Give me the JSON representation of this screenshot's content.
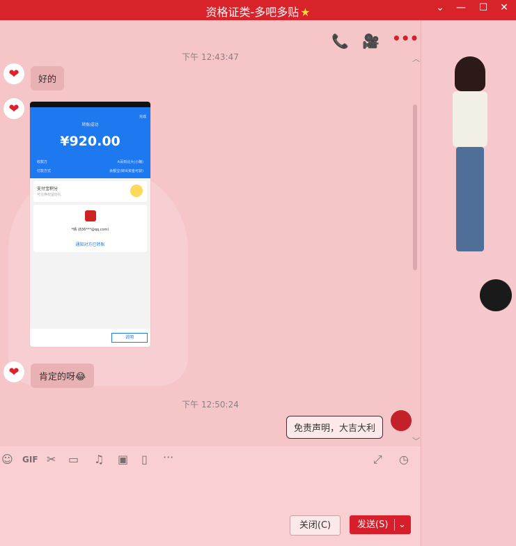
{
  "window": {
    "title": "资格证类-多吧多贴",
    "star_icon": "star-icon",
    "accent": "#d9232b"
  },
  "chat": {
    "timestamps": [
      "下午 12:43:47",
      "下午 12:50:24"
    ],
    "messages": [
      {
        "from": "friend",
        "text": "好的"
      },
      {
        "from": "friend",
        "type": "image"
      },
      {
        "from": "friend",
        "text": "肯定的呀"
      },
      {
        "from": "me",
        "text": "免责声明，大吉大利"
      }
    ],
    "screenshot": {
      "status": "转账成功",
      "done": "完成",
      "amount": "¥920.00",
      "payee_label": "收款方",
      "payee_value": "A百刻北大(小赚)",
      "pay_method_label": "付款方式",
      "pay_method_value": "余额宝(转出资金可获)",
      "reward_title": "支付宝积分",
      "reward_sub": "可兑换权益好礼",
      "contact": "*晴 (836***@qq.com)",
      "notify": "通知对方已转账",
      "footer_btn": "说明"
    }
  },
  "buttons": {
    "close": "关闭(C)",
    "send": "发送(S)"
  }
}
